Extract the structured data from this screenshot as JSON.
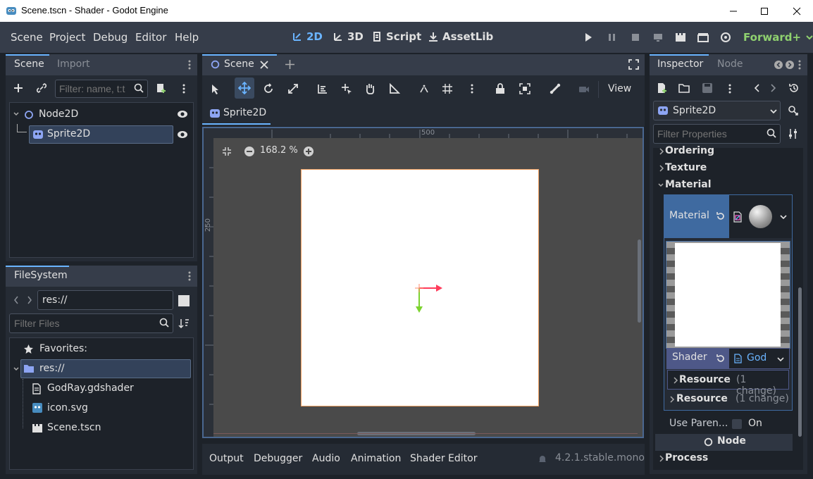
{
  "window": {
    "title": "Scene.tscn - Shader - Godot Engine"
  },
  "menubar": {
    "items": [
      "Scene",
      "Project",
      "Debug",
      "Editor",
      "Help"
    ],
    "workspaces": [
      "2D",
      "3D",
      "Script",
      "AssetLib"
    ],
    "renderer": "Forward+"
  },
  "scene_dock": {
    "tabs": [
      "Scene",
      "Import"
    ],
    "filter_placeholder": "Filter: name, t:t",
    "nodes": [
      "Node2D",
      "Sprite2D"
    ]
  },
  "filesystem": {
    "title": "FileSystem",
    "path": "res://",
    "filter_placeholder": "Filter Files",
    "favorites": "Favorites:",
    "root": "res://",
    "files": [
      "GodRay.gdshader",
      "icon.svg",
      "Scene.tscn"
    ]
  },
  "editor": {
    "scene_tab": "Scene",
    "view_label": "View",
    "breadcrumb": "Sprite2D",
    "zoom": "168.2 %",
    "ruler_h": "500",
    "ruler_v": "250",
    "bottom_tabs": [
      "Output",
      "Debugger",
      "Audio",
      "Animation",
      "Shader Editor"
    ],
    "version": "4.2.1.stable.mono"
  },
  "inspector": {
    "tabs": [
      "Inspector",
      "Node"
    ],
    "object": "Sprite2D",
    "filter_placeholder": "Filter Properties",
    "sections": [
      "Ordering",
      "Texture",
      "Material"
    ],
    "material_label": "Material",
    "shader_label": "Shader",
    "shader_value": "God",
    "resource_1": {
      "label": "Resource",
      "changes": "(1 change)"
    },
    "resource_2": {
      "label": "Resource",
      "changes": "(1 change)"
    },
    "use_parent_label": "Use Paren...",
    "use_parent_value": "On",
    "node_section": "Node",
    "process_section": "Process"
  },
  "colors": {
    "accent": "#6ab4ff",
    "renderer": "#8fd16f",
    "x_axis": "#ff3b5b",
    "y_axis": "#7cd32f",
    "sprite_border": "#f0a060"
  }
}
